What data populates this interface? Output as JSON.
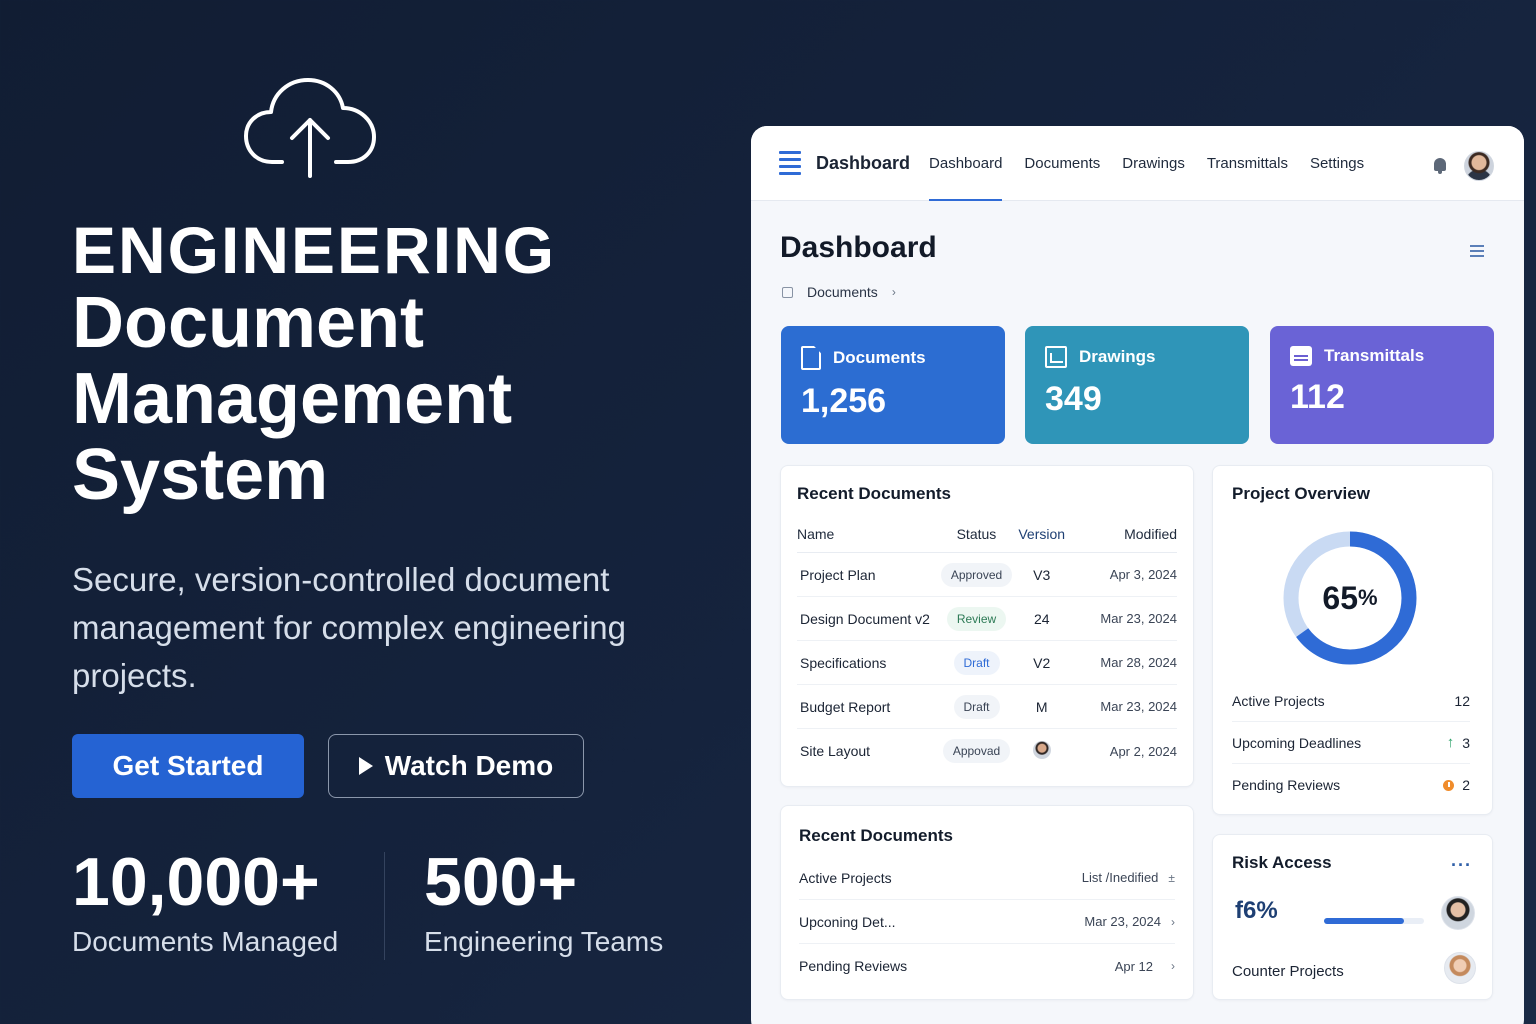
{
  "hero": {
    "headline_line1": "ENGINEERING",
    "headline_line2": "Document",
    "headline_line3": "Management",
    "headline_line4": "System",
    "subtitle": "Secure, version-controlled document management for complex engineering projects.",
    "primary_cta": "Get Started",
    "secondary_cta": "Watch Demo",
    "stats": [
      {
        "value": "10,000+",
        "label": "Documents Managed"
      },
      {
        "value": "500+",
        "label": "Engineering Teams"
      }
    ]
  },
  "app": {
    "brand": "Dashboard",
    "nav": [
      "Dashboard",
      "Documents",
      "Drawings",
      "Transmittals",
      "Settings"
    ],
    "active_nav": "Dashboard",
    "page_title": "Dashboard",
    "breadcrumb": "Documents",
    "metrics": [
      {
        "label": "Documents",
        "value": "1,256",
        "color": "#2c6dd2"
      },
      {
        "label": "Drawings",
        "value": "349",
        "color": "#2f95b8"
      },
      {
        "label": "Transmittals",
        "value": "112",
        "color": "#6a63d6"
      }
    ],
    "recent_documents": {
      "title": "Recent Documents",
      "columns": [
        "Name",
        "Status",
        "Version",
        "Modified"
      ],
      "rows": [
        {
          "name": "Project Plan",
          "status": "Approved",
          "version": "V3",
          "modified": "Apr 3, 2024"
        },
        {
          "name": "Design Document v2",
          "status": "Review",
          "version": "24",
          "modified": "Mar 23, 2024"
        },
        {
          "name": "Specifications",
          "status": "Draft",
          "version": "V2",
          "modified": "Mar 28, 2024"
        },
        {
          "name": "Budget Report",
          "status": "Draft",
          "version": "M",
          "modified": "Mar 23, 2024"
        },
        {
          "name": "Site Layout",
          "status": "Appovad",
          "version": "",
          "modified": "Apr 2, 2024"
        }
      ]
    },
    "project_overview": {
      "title": "Project Overview",
      "percent": "65",
      "percent_sign": "%",
      "progress": 0.65,
      "rows": [
        {
          "label": "Active Projects",
          "value": "12"
        },
        {
          "label": "Upcoming Deadlines",
          "value": "3"
        },
        {
          "label": "Pending Reviews",
          "value": "2"
        }
      ]
    },
    "recent_documents_2": {
      "title": "Recent Documents",
      "rows": [
        {
          "label": "Active Projects",
          "right": "List /Inedified",
          "icon": "pin-icon"
        },
        {
          "label": "Upconing Det...",
          "right": "Mar 23, 2024",
          "icon": "chevron-right-icon"
        },
        {
          "label": "Pending Reviews",
          "right": "Apr 12",
          "icon": "chevron-right-icon"
        }
      ]
    },
    "risk_access": {
      "title": "Risk Access",
      "percent_text": "f6%",
      "progress": 0.8,
      "footer": "Counter Projects"
    }
  }
}
